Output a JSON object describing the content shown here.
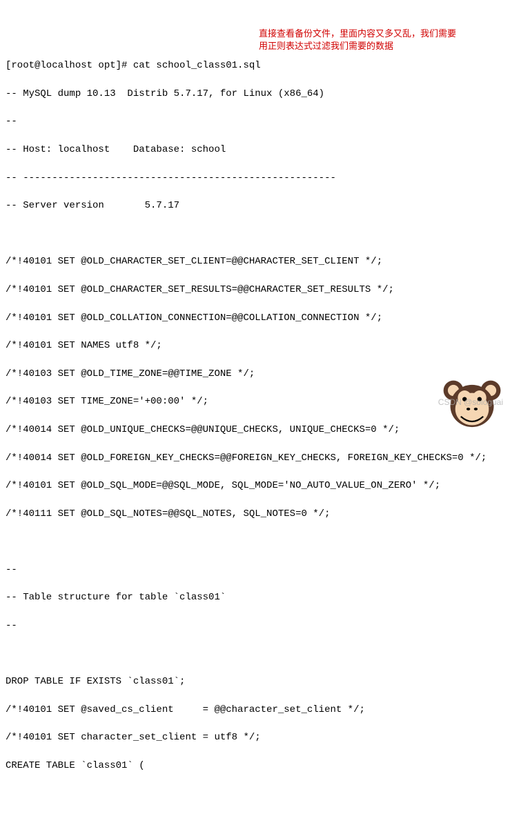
{
  "prompt": "[root@localhost opt]# cat school_class01.sql",
  "lines": [
    "-- MySQL dump 10.13  Distrib 5.7.17, for Linux (x86_64)",
    "--",
    "-- Host: localhost    Database: school",
    "-- ------------------------------------------------------",
    "-- Server version       5.7.17",
    "",
    "/*!40101 SET @OLD_CHARACTER_SET_CLIENT=@@CHARACTER_SET_CLIENT */;",
    "/*!40101 SET @OLD_CHARACTER_SET_RESULTS=@@CHARACTER_SET_RESULTS */;",
    "/*!40101 SET @OLD_COLLATION_CONNECTION=@@COLLATION_CONNECTION */;",
    "/*!40101 SET NAMES utf8 */;",
    "/*!40103 SET @OLD_TIME_ZONE=@@TIME_ZONE */;",
    "/*!40103 SET TIME_ZONE='+00:00' */;",
    "/*!40014 SET @OLD_UNIQUE_CHECKS=@@UNIQUE_CHECKS, UNIQUE_CHECKS=0 */;",
    "/*!40014 SET @OLD_FOREIGN_KEY_CHECKS=@@FOREIGN_KEY_CHECKS, FOREIGN_KEY_CHECKS=0 */;",
    "/*!40101 SET @OLD_SQL_MODE=@@SQL_MODE, SQL_MODE='NO_AUTO_VALUE_ON_ZERO' */;",
    "/*!40111 SET @OLD_SQL_NOTES=@@SQL_NOTES, SQL_NOTES=0 */;",
    "",
    "--",
    "-- Table structure for table `class01`",
    "--",
    "",
    "DROP TABLE IF EXISTS `class01`;",
    "/*!40101 SET @saved_cs_client     = @@character_set_client */;",
    "/*!40101 SET character_set_client = utf8 */;",
    "CREATE TABLE `class01` ("
  ],
  "annotation": {
    "line1": "直接查看备份文件，里面内容又多又乱，我们需要",
    "line2": "用正则表达式过滤我们需要的数据"
  },
  "watermark": "CSDN @sologuai"
}
